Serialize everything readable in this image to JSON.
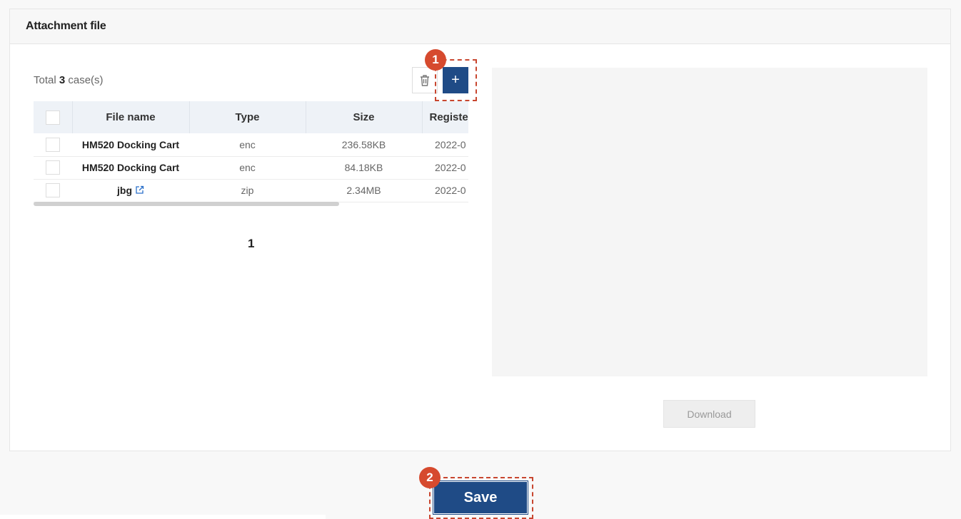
{
  "panel": {
    "title": "Attachment file"
  },
  "toolbar": {
    "total_prefix": "Total",
    "total_count": "3",
    "total_suffix": "case(s)",
    "add_label": "+",
    "badge1": "1"
  },
  "table": {
    "columns": [
      "File name",
      "Type",
      "Size",
      "Register"
    ],
    "rows": [
      {
        "name": "HM520 Docking Cart",
        "type": "enc",
        "size": "236.58KB",
        "date": "2022-0"
      },
      {
        "name": "HM520 Docking Cart",
        "type": "enc",
        "size": "84.18KB",
        "date": "2022-0"
      },
      {
        "name": "jbg",
        "type": "zip",
        "size": "2.34MB",
        "date": "2022-0"
      }
    ]
  },
  "pagination": {
    "current": "1"
  },
  "preview": {
    "download_label": "Download"
  },
  "footer": {
    "save_label": "Save",
    "badge2": "2"
  },
  "colors": {
    "primary": "#1f4b86",
    "highlight": "#d64a2e"
  }
}
